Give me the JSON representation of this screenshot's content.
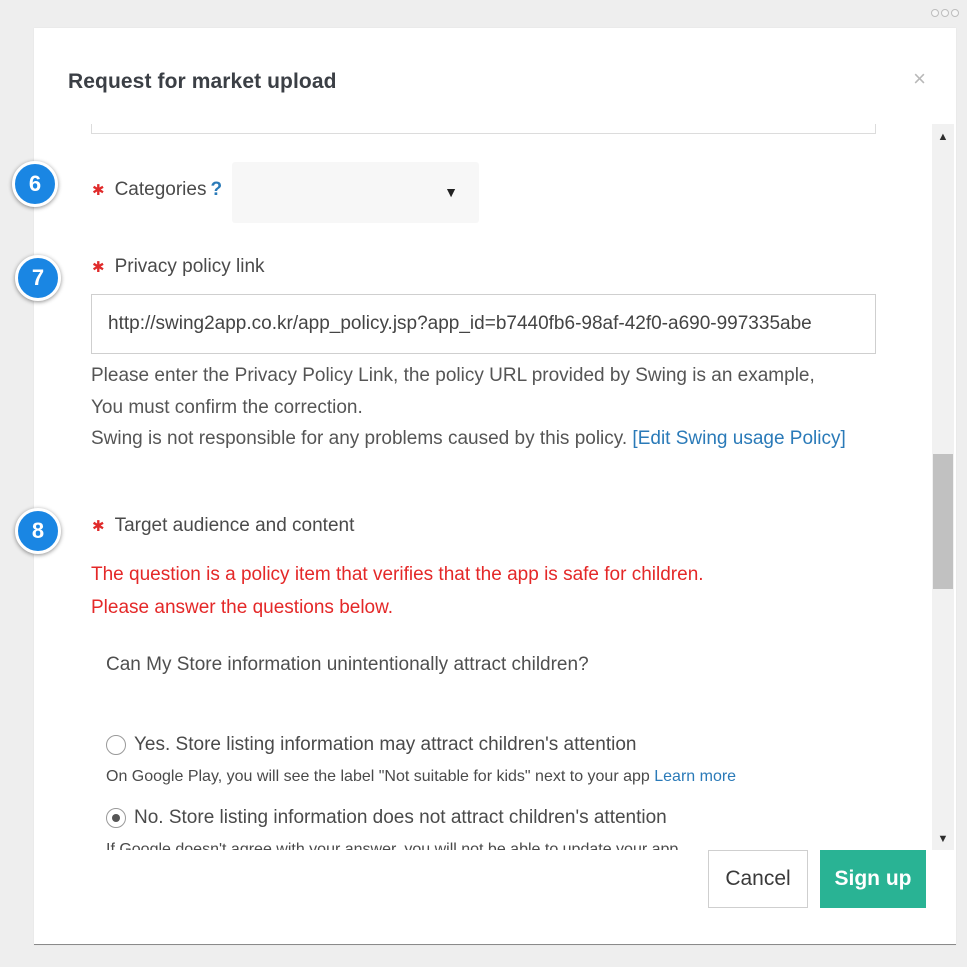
{
  "modal": {
    "title": "Request for market upload",
    "close_glyph": "×"
  },
  "badges": [
    "6",
    "7",
    "8"
  ],
  "categories": {
    "label": "Categories",
    "help": "?",
    "selected_value": "",
    "arrow": "▼"
  },
  "privacy": {
    "label": "Privacy policy link",
    "value": "http://swing2app.co.kr/app_policy.jsp?app_id=b7440fb6-98af-42f0-a690-997335abe",
    "help_line1": "Please enter the Privacy Policy Link, the policy URL provided by Swing is an example,",
    "help_line2": "You must confirm the correction.",
    "help_line3": "Swing is not responsible for any problems caused by this policy. ",
    "help_link": "[Edit Swing usage Policy]"
  },
  "audience": {
    "label": "Target audience and content",
    "warning_line1": "The question is a policy item that verifies that the app is safe for children.",
    "warning_line2": "Please answer the questions below.",
    "question": "Can My Store information unintentionally attract children?",
    "options": [
      {
        "label": "Yes. Store listing information may attract children's attention",
        "note": "On Google Play, you will see the label \"Not suitable for kids\" next to your app ",
        "note_link": "Learn more",
        "checked": false
      },
      {
        "label": "No. Store listing information does not attract children's attention",
        "note": "If Google doesn't agree with your answer, you will not be able to update your app",
        "checked": true
      }
    ]
  },
  "footer": {
    "cancel_label": "Cancel",
    "signup_label": "Sign up"
  },
  "colors": {
    "accent_blue": "#1a86e3",
    "link": "#2a7ab8",
    "required_red": "#e02b2b",
    "warning_red": "#e42828",
    "signup_green": "#29b394"
  },
  "icons": {
    "required": "asterisk-icon",
    "close": "close-icon",
    "dropdown": "caret-down-icon",
    "scroll_up": "scroll-up-arrow-icon",
    "scroll_down": "scroll-down-arrow-icon"
  }
}
